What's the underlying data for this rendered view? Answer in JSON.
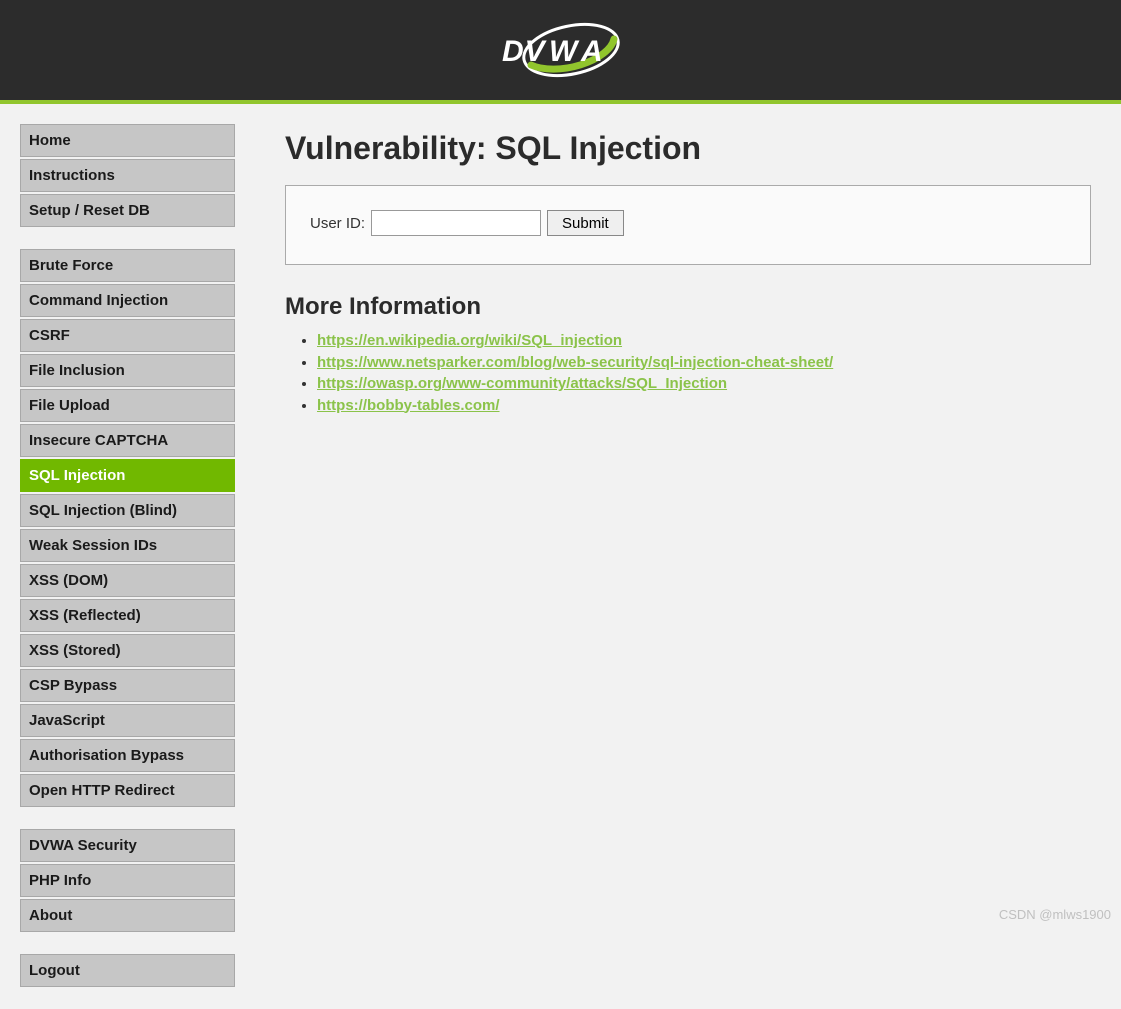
{
  "logo": {
    "letters_left": "DV",
    "letters_mid": "W",
    "letters_right": "A"
  },
  "sidebar": {
    "groups": [
      {
        "items": [
          {
            "label": "Home",
            "name": "nav-home"
          },
          {
            "label": "Instructions",
            "name": "nav-instructions"
          },
          {
            "label": "Setup / Reset DB",
            "name": "nav-setup-reset-db"
          }
        ]
      },
      {
        "items": [
          {
            "label": "Brute Force",
            "name": "nav-brute-force"
          },
          {
            "label": "Command Injection",
            "name": "nav-command-injection"
          },
          {
            "label": "CSRF",
            "name": "nav-csrf"
          },
          {
            "label": "File Inclusion",
            "name": "nav-file-inclusion"
          },
          {
            "label": "File Upload",
            "name": "nav-file-upload"
          },
          {
            "label": "Insecure CAPTCHA",
            "name": "nav-insecure-captcha"
          },
          {
            "label": "SQL Injection",
            "name": "nav-sql-injection",
            "selected": true
          },
          {
            "label": "SQL Injection (Blind)",
            "name": "nav-sql-injection-blind"
          },
          {
            "label": "Weak Session IDs",
            "name": "nav-weak-session-ids"
          },
          {
            "label": "XSS (DOM)",
            "name": "nav-xss-dom"
          },
          {
            "label": "XSS (Reflected)",
            "name": "nav-xss-reflected"
          },
          {
            "label": "XSS (Stored)",
            "name": "nav-xss-stored"
          },
          {
            "label": "CSP Bypass",
            "name": "nav-csp-bypass"
          },
          {
            "label": "JavaScript",
            "name": "nav-javascript"
          },
          {
            "label": "Authorisation Bypass",
            "name": "nav-authorisation-bypass"
          },
          {
            "label": "Open HTTP Redirect",
            "name": "nav-open-http-redirect"
          }
        ]
      },
      {
        "items": [
          {
            "label": "DVWA Security",
            "name": "nav-dvwa-security"
          },
          {
            "label": "PHP Info",
            "name": "nav-php-info"
          },
          {
            "label": "About",
            "name": "nav-about"
          }
        ]
      },
      {
        "items": [
          {
            "label": "Logout",
            "name": "nav-logout"
          }
        ]
      }
    ]
  },
  "page": {
    "title": "Vulnerability: SQL Injection",
    "form": {
      "user_id_label": "User ID:",
      "user_id_value": "",
      "submit_label": "Submit"
    },
    "more_info_heading": "More Information",
    "links": [
      "https://en.wikipedia.org/wiki/SQL_injection",
      "https://www.netsparker.com/blog/web-security/sql-injection-cheat-sheet/",
      "https://owasp.org/www-community/attacks/SQL_Injection",
      "https://bobby-tables.com/"
    ]
  },
  "watermark": "CSDN @mlws1900"
}
